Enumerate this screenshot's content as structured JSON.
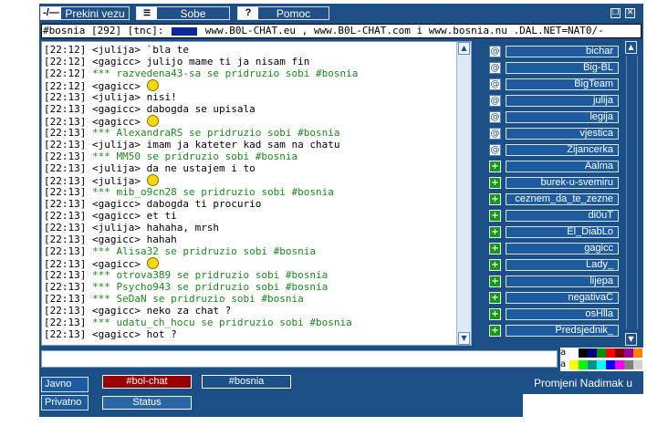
{
  "toolbar": {
    "disconnect_label": "Prekini vezu",
    "rooms_label": "Sobe",
    "help_label": "Pomoc",
    "disconnect_icon": "-/—",
    "help_icon": "?"
  },
  "topic": {
    "prefix": "#bosnia [292] [tnc]: ",
    "highlight": "Ar",
    "text": " www.B0L-CHAT.eu , www.B0L-CHAT.com i www.bosnia.nu .DAL.NET=NAT0/-"
  },
  "messages": [
    {
      "time": "[22:12]",
      "text": "<julija> `bla te",
      "type": "msg"
    },
    {
      "time": "[22:12]",
      "text": "<gagicc> julijo mame ti ja nisam fin",
      "type": "msg"
    },
    {
      "time": "[22:12]",
      "text": "*** razvedena43-sa se pridruzio sobi #bosnia",
      "type": "join"
    },
    {
      "time": "[22:12]",
      "text": "<gagicc> ",
      "type": "msg",
      "smiley": "sad"
    },
    {
      "time": "[22:13]",
      "text": "<julija> nisi!",
      "type": "msg"
    },
    {
      "time": "[22:13]",
      "text": "<gagicc> dabogda se upisala",
      "type": "msg"
    },
    {
      "time": "[22:13]",
      "text": "<gagicc> ",
      "type": "msg",
      "smiley": "grin"
    },
    {
      "time": "[22:13]",
      "text": "*** AlexandraRS se pridruzio sobi #bosnia",
      "type": "join"
    },
    {
      "time": "[22:13]",
      "text": "<julija> imam ja kateter kad sam na chatu",
      "type": "msg"
    },
    {
      "time": "[22:13]",
      "text": "*** MM50 se pridruzio sobi #bosnia",
      "type": "join"
    },
    {
      "time": "[22:13]",
      "text": "<julija> da ne ustajem i to",
      "type": "msg"
    },
    {
      "time": "[22:13]",
      "text": "<julija> ",
      "type": "msg",
      "smiley": "smile"
    },
    {
      "time": "[22:13]",
      "text": "*** mib_o9cn28 se pridruzio sobi #bosnia",
      "type": "join"
    },
    {
      "time": "[22:13]",
      "text": "<gagicc> dabogda ti procurio",
      "type": "msg"
    },
    {
      "time": "[22:13]",
      "text": "<gagicc> et ti",
      "type": "msg"
    },
    {
      "time": "[22:13]",
      "text": "<julija> hahaha, mrsh",
      "type": "msg"
    },
    {
      "time": "[22:13]",
      "text": "<gagicc> hahah",
      "type": "msg"
    },
    {
      "time": "[22:13]",
      "text": "*** Alisa32 se pridruzio sobi #bosnia",
      "type": "join"
    },
    {
      "time": "[22:13]",
      "text": "<gagicc> ",
      "type": "msg",
      "smiley": "wink"
    },
    {
      "time": "[22:13]",
      "text": "*** otrova389 se pridruzio sobi #bosnia",
      "type": "join"
    },
    {
      "time": "[22:13]",
      "text": "*** Psycho943 se pridruzio sobi #bosnia",
      "type": "join"
    },
    {
      "time": "[22:13]",
      "text": "*** SeDaN se pridruzio sobi #bosnia",
      "type": "join"
    },
    {
      "time": "[22:13]",
      "text": "<gagicc> neko za chat ?",
      "type": "msg"
    },
    {
      "time": "[22:13]",
      "text": "*** udatu_ch_hocu se pridruzio sobi #bosnia",
      "type": "join"
    },
    {
      "time": "[22:13]",
      "text": "<gagicc> hot ?",
      "type": "msg"
    }
  ],
  "users": [
    {
      "mode": "@",
      "name": "bichar"
    },
    {
      "mode": "@",
      "name": "Big-BL"
    },
    {
      "mode": "@",
      "name": "BigTeam"
    },
    {
      "mode": "@",
      "name": "julija"
    },
    {
      "mode": "@",
      "name": "legija"
    },
    {
      "mode": "@",
      "name": "vjestica"
    },
    {
      "mode": "@",
      "name": "Zijancerka"
    },
    {
      "mode": "+",
      "name": "Aalma"
    },
    {
      "mode": "+",
      "name": "burek-u-svemiru"
    },
    {
      "mode": "+",
      "name": "ceznem_da_te_zezne"
    },
    {
      "mode": "+",
      "name": "di0uT"
    },
    {
      "mode": "+",
      "name": "El_DiabLo"
    },
    {
      "mode": "+",
      "name": "gagicc"
    },
    {
      "mode": "+",
      "name": "Lady_"
    },
    {
      "mode": "+",
      "name": "lijepa"
    },
    {
      "mode": "+",
      "name": "negativaC"
    },
    {
      "mode": "+",
      "name": "osHlla"
    },
    {
      "mode": "+",
      "name": "Predsjednik_"
    }
  ],
  "input": {
    "value": ""
  },
  "palette": {
    "label": "a",
    "row1": [
      "#ffffff",
      "#000000",
      "#00007f",
      "#009300",
      "#ff0000",
      "#7f0000",
      "#9c009c",
      "#fc7f00"
    ],
    "row2": [
      "#ffff00",
      "#00fc00",
      "#009393",
      "#00ffff",
      "#0000fc",
      "#ff00ff",
      "#7f7f7f",
      "#d2d2d2"
    ]
  },
  "bottom": {
    "public_label": "Javno",
    "private_label": "Privatno",
    "channels": [
      {
        "label": "#bol-chat",
        "color": "#9b0000"
      },
      {
        "label": "#bosnia",
        "color": "#1b4f86"
      }
    ],
    "status_label": "Status",
    "change_nick_label": "Promjeni Nadimak u"
  }
}
